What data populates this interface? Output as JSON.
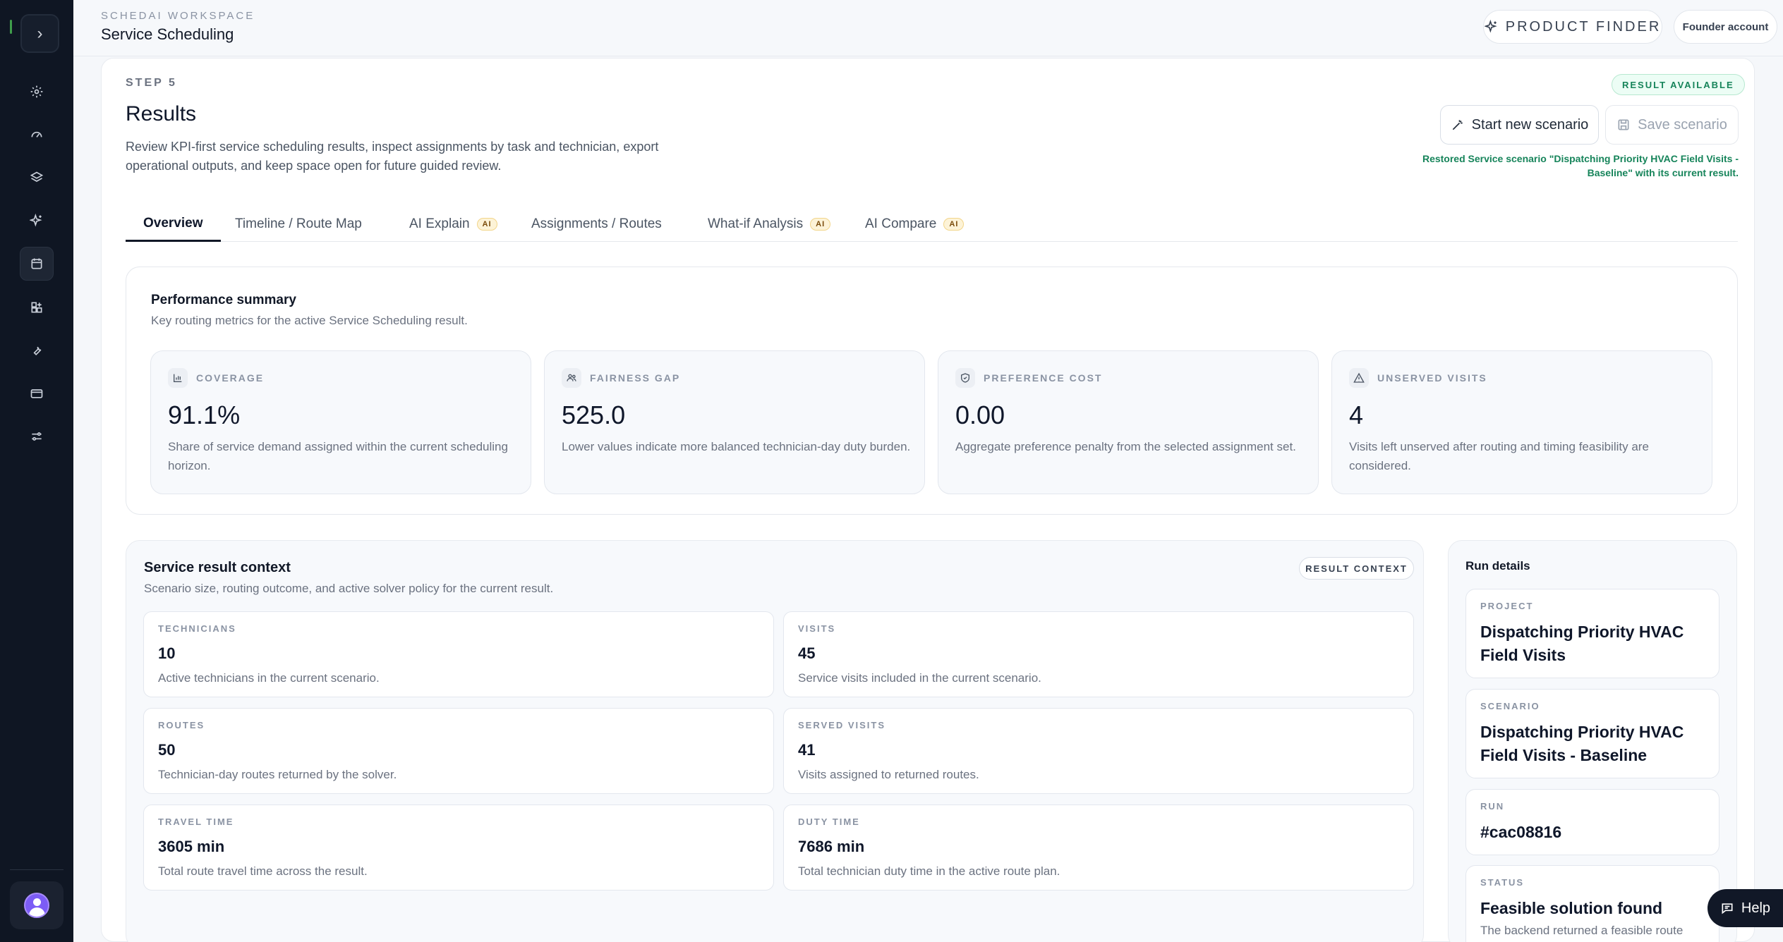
{
  "sidebar": {
    "toggle_icon": "chevron-right-icon",
    "items": [
      {
        "icon": "gear-icon"
      },
      {
        "icon": "gauge-icon"
      },
      {
        "icon": "layers-icon"
      },
      {
        "icon": "sparkles-icon"
      },
      {
        "icon": "calendar-icon",
        "active": true
      },
      {
        "icon": "apps-icon"
      },
      {
        "icon": "wrench-icon"
      },
      {
        "icon": "card-icon"
      },
      {
        "icon": "sliders-icon"
      }
    ]
  },
  "topbar": {
    "workspace_label": "SCHEDAI WORKSPACE",
    "page_title": "Service Scheduling",
    "product_finder": "PRODUCT FINDER",
    "account": "Founder account"
  },
  "results": {
    "step": "STEP 5",
    "title": "Results",
    "description": "Review KPI-first service scheduling results, inspect assignments by task and technician, export operational outputs, and keep space open for future guided review.",
    "badge": "RESULT AVAILABLE",
    "start_new": "Start new scenario",
    "save": "Save scenario",
    "restored_msg": "Restored Service scenario \"Dispatching Priority HVAC Field Visits - Baseline\" with its current result."
  },
  "tabs": [
    {
      "label": "Overview",
      "ai": false,
      "active": true
    },
    {
      "label": "Timeline / Route Map",
      "ai": false
    },
    {
      "label": "AI Explain",
      "ai": true
    },
    {
      "label": "Assignments / Routes",
      "ai": false
    },
    {
      "label": "What-if Analysis",
      "ai": true
    },
    {
      "label": "AI Compare",
      "ai": true
    }
  ],
  "ai_pill": "AI",
  "performance": {
    "title": "Performance summary",
    "subtitle": "Key routing metrics for the active Service Scheduling result.",
    "kpis": [
      {
        "label": "COVERAGE",
        "value": "91.1%",
        "desc": "Share of service demand assigned within the current scheduling horizon.",
        "icon": "bar-chart-icon"
      },
      {
        "label": "FAIRNESS GAP",
        "value": "525.0",
        "desc": "Lower values indicate more balanced technician-day duty burden.",
        "icon": "users-icon"
      },
      {
        "label": "PREFERENCE COST",
        "value": "0.00",
        "desc": "Aggregate preference penalty from the selected assignment set.",
        "icon": "shield-icon"
      },
      {
        "label": "UNSERVED VISITS",
        "value": "4",
        "desc": "Visits left unserved after routing and timing feasibility are considered.",
        "icon": "warning-icon"
      }
    ]
  },
  "context": {
    "title": "Service result context",
    "subtitle": "Scenario size, routing outcome, and active solver policy for the current result.",
    "badge": "RESULT CONTEXT",
    "stats": [
      {
        "label": "TECHNICIANS",
        "value": "10",
        "desc": "Active technicians in the current scenario."
      },
      {
        "label": "VISITS",
        "value": "45",
        "desc": "Service visits included in the current scenario."
      },
      {
        "label": "ROUTES",
        "value": "50",
        "desc": "Technician-day routes returned by the solver."
      },
      {
        "label": "SERVED VISITS",
        "value": "41",
        "desc": "Visits assigned to returned routes."
      },
      {
        "label": "TRAVEL TIME",
        "value": "3605 min",
        "desc": "Total route travel time across the result."
      },
      {
        "label": "DUTY TIME",
        "value": "7686 min",
        "desc": "Total technician duty time in the active route plan."
      }
    ]
  },
  "run_details": {
    "title": "Run details",
    "items": [
      {
        "label": "PROJECT",
        "value": "Dispatching Priority HVAC Field Visits"
      },
      {
        "label": "SCENARIO",
        "value": "Dispatching Priority HVAC Field Visits - Baseline"
      },
      {
        "label": "RUN",
        "value": "#cac08816"
      },
      {
        "label": "STATUS",
        "value": "Feasible solution found",
        "desc": "The backend returned a feasible route"
      }
    ]
  },
  "help": "Help"
}
